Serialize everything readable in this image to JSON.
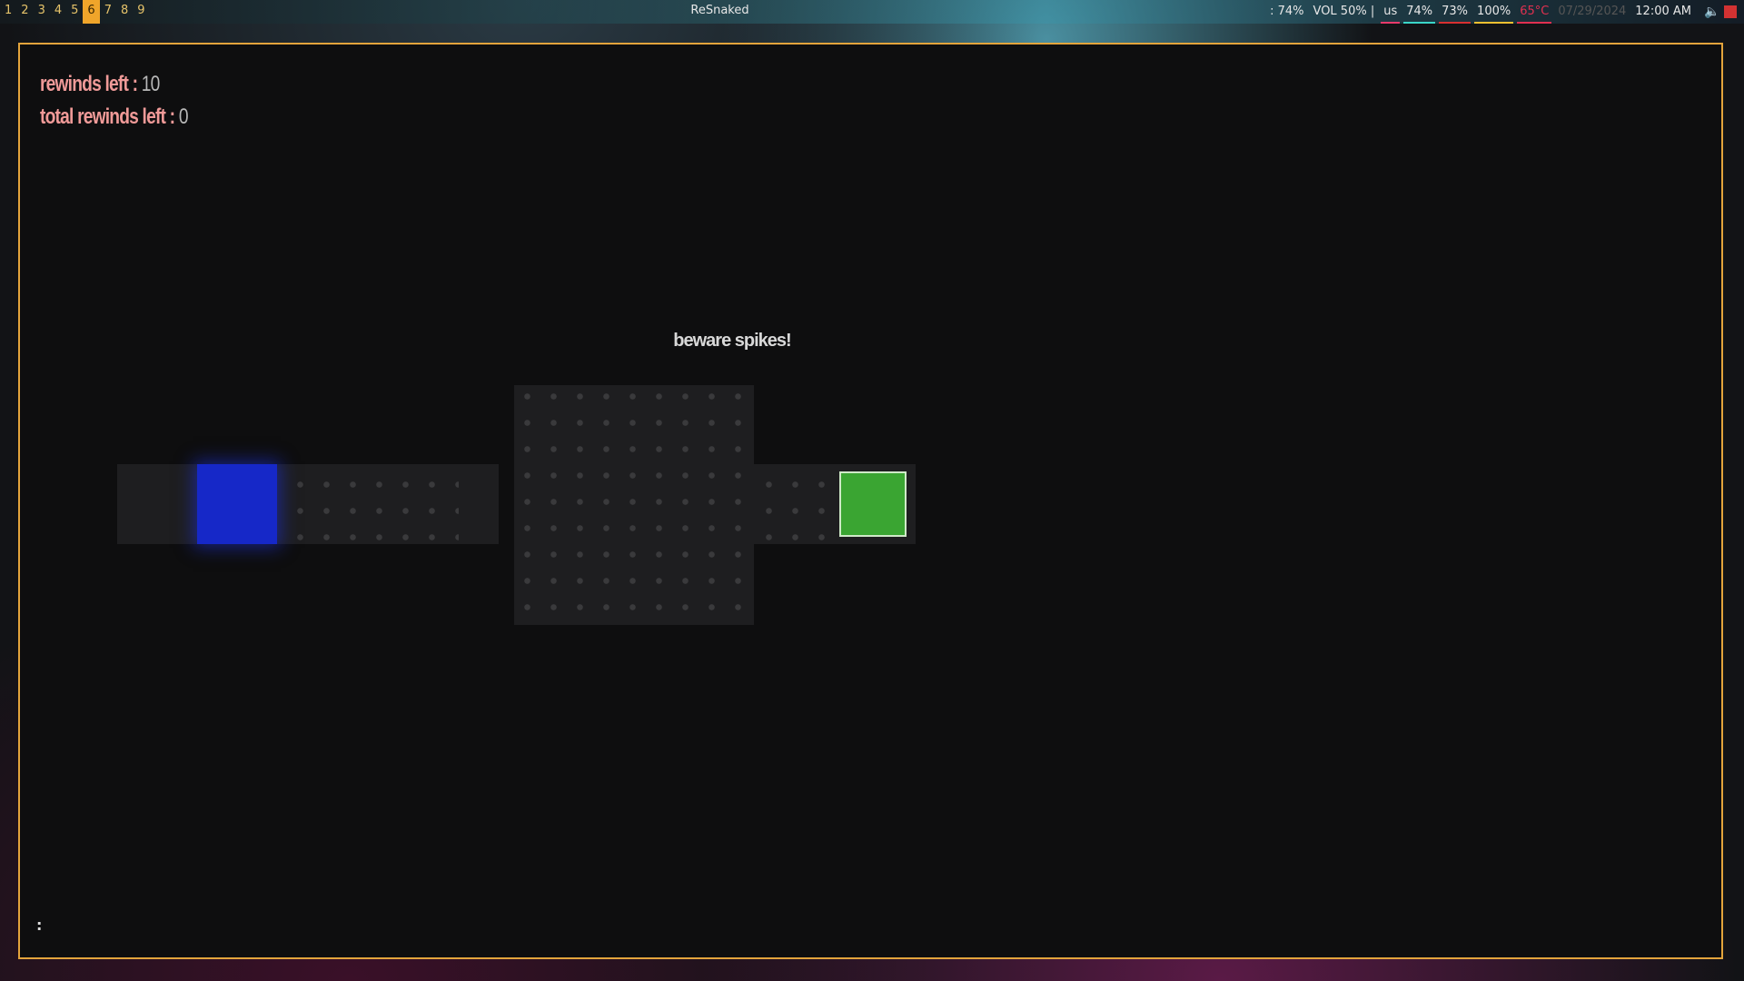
{
  "topbar": {
    "workspaces": [
      "1",
      "2",
      "3",
      "4",
      "5",
      "6",
      "7",
      "8",
      "9"
    ],
    "active_workspace": "6",
    "window_title": "ReSnaked",
    "status": {
      "brightness": ": 74%",
      "volume": "VOL 50%  |",
      "keyboard": "us",
      "cpu": "74%",
      "mem": "73%",
      "battery": "100%",
      "temp": "65°C",
      "date": "07/29/2024",
      "time": "12:00 AM"
    },
    "colors": {
      "keyboard": "#e83a6a",
      "cpu": "#3ad6c8",
      "mem": "#d83030",
      "battery": "#f0c030",
      "temp": "#e03050"
    }
  },
  "game": {
    "hud": {
      "rewinds_label": "rewinds left :",
      "rewinds_value": "10",
      "total_label": "total rewinds left :",
      "total_value": "0"
    },
    "message": "beware spikes!",
    "cmdline": ":",
    "colors": {
      "border": "#e3a43c",
      "player": "#1628c8",
      "goal": "#3aa532",
      "hud_label": "#f09a98"
    }
  }
}
